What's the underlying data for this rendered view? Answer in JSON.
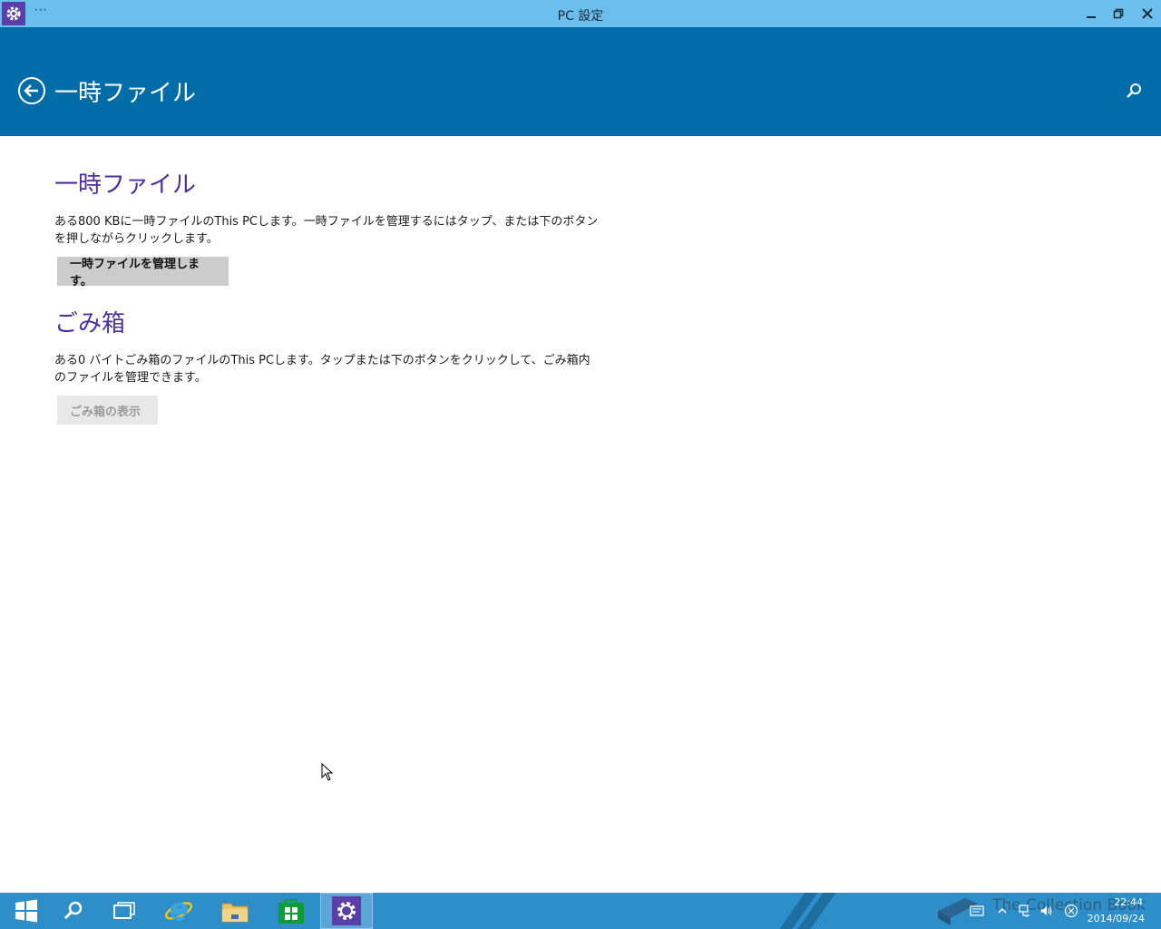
{
  "window": {
    "title": "PC 設定",
    "menu_glyph": "···"
  },
  "header": {
    "title": "一時ファイル"
  },
  "sections": [
    {
      "title": "一時ファイル",
      "description": "ある800 KBに一時ファイルのThis PCします。一時ファイルを管理するにはタップ、または下のボタンを押しながらクリックします。",
      "button_label": "一時ファイルを管理します。"
    },
    {
      "title": "ごみ箱",
      "description": "ある0 バイトごみ箱のファイルのThis PCします。タップまたは下のボタンをクリックして、ごみ箱内のファイルを管理できます。",
      "button_label": "ごみ箱の表示"
    }
  ],
  "taskbar": {
    "items": [
      "start-icon",
      "search-icon",
      "task-view-icon",
      "internet-explorer-icon",
      "file-explorer-icon",
      "store-icon",
      "settings-icon"
    ],
    "active_item": "settings-icon",
    "clock_time": "22:44",
    "clock_date": "2014/09/24",
    "watermark": "The Collection Book"
  },
  "colors": {
    "titlebar": "#6bbfef",
    "header": "#006ca8",
    "accent": "#4b2fa0",
    "taskbar": "#2d8ec9"
  }
}
